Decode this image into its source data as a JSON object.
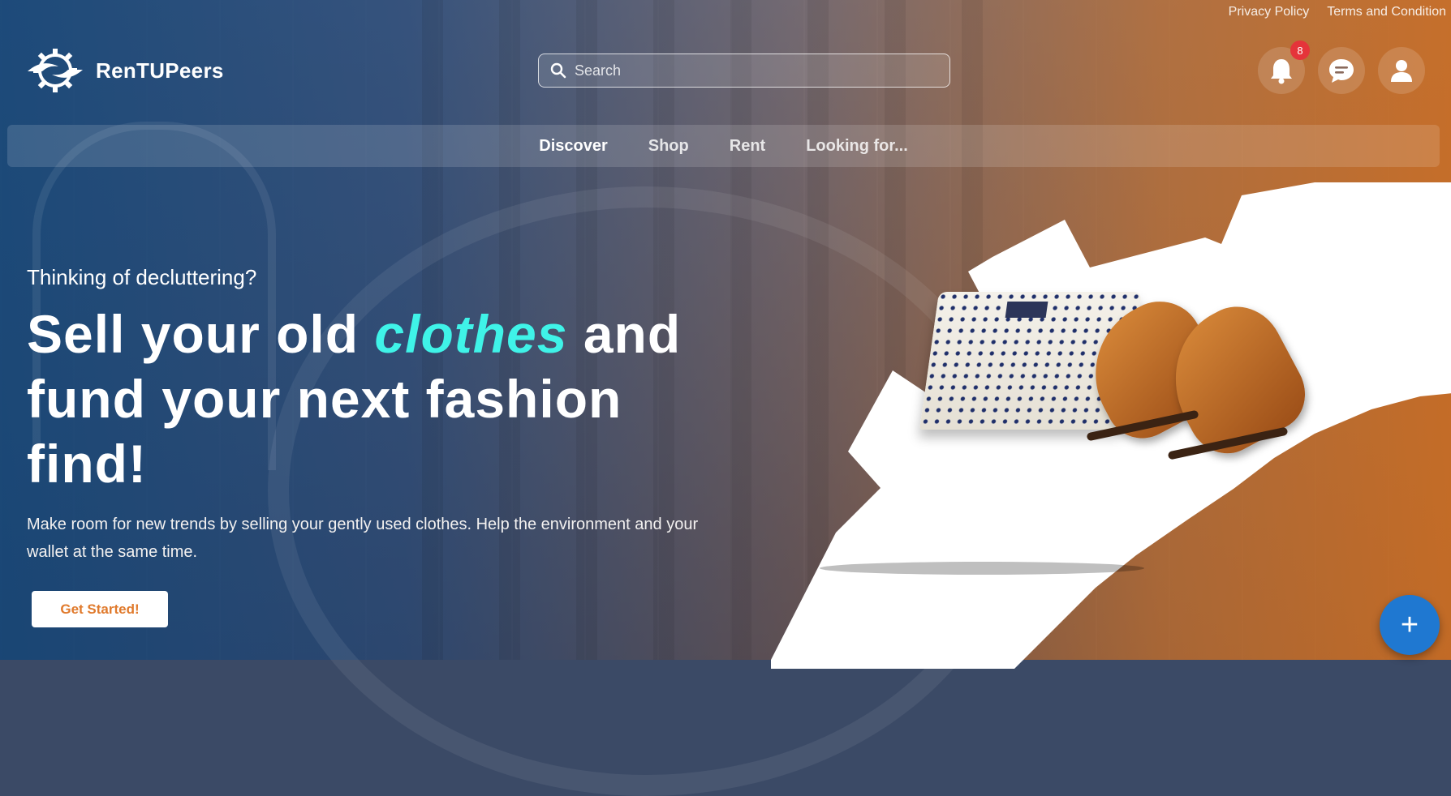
{
  "top_links": {
    "privacy": "Privacy Policy",
    "terms": "Terms and Condition"
  },
  "brand": {
    "name": "RenTUPeers",
    "logo_icon": "gear-swirl-icon"
  },
  "search": {
    "placeholder": "Search",
    "icon": "search-icon"
  },
  "header_icons": {
    "notifications": {
      "icon": "bell-icon",
      "badge": "8"
    },
    "messages": {
      "icon": "chat-icon"
    },
    "profile": {
      "icon": "user-icon"
    }
  },
  "nav": {
    "items": [
      {
        "label": "Discover",
        "active": true
      },
      {
        "label": "Shop",
        "active": false
      },
      {
        "label": "Rent",
        "active": false
      },
      {
        "label": "Looking for...",
        "active": false
      }
    ]
  },
  "hero": {
    "subtitle": "Thinking of decluttering?",
    "title_part1": "Sell your old ",
    "title_accent": "clothes",
    "title_part2": " and fund your next fashion find!",
    "description": "Make room for new trends by selling your gently used clothes. Help the environment and your wallet at the same time.",
    "cta_label": "Get Started!"
  },
  "fab": {
    "icon": "plus-icon",
    "label": "+"
  },
  "colors": {
    "accent_cyan": "#3ff3e8",
    "cta_text": "#e07a2c",
    "fab_blue": "#1f78d1",
    "badge_red": "#e5343a"
  }
}
